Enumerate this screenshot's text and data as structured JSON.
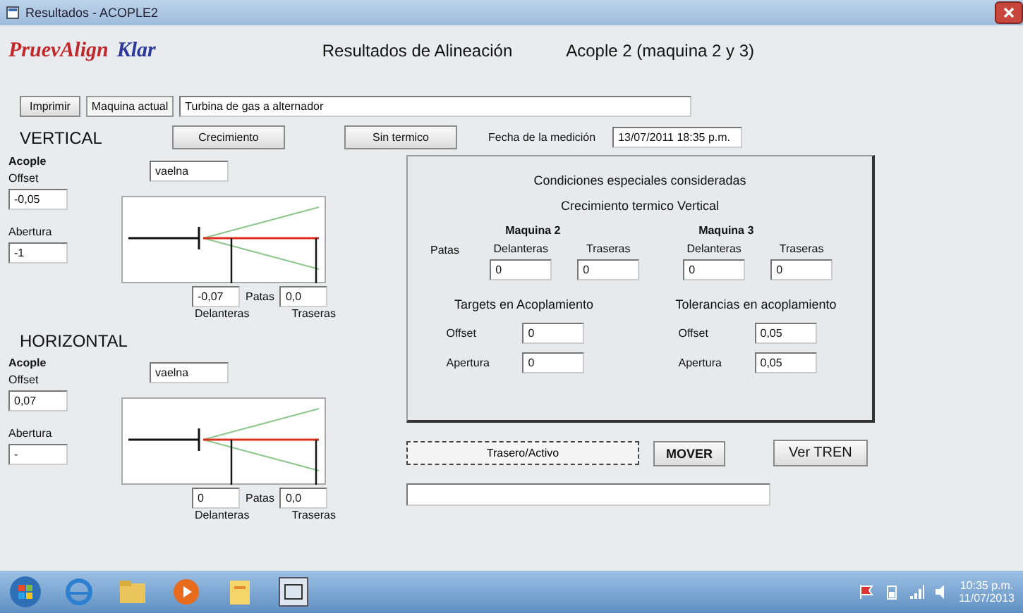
{
  "window": {
    "title": "Resultados - ACOPLE2"
  },
  "header": {
    "logo_part_1": "PruevAlign",
    "logo_part_2": "Klar",
    "title": "Resultados de Alineación",
    "coupling": "Acople 2  (maquina 2 y 3)"
  },
  "toolbar": {
    "print_button": "Imprimir",
    "machine_label": "Maquina actual",
    "machine_value": "Turbina de gas a alternador"
  },
  "options": {
    "buttons": [
      "Crecimiento",
      "Sin termico"
    ],
    "date_label": "Fecha de la medición",
    "date_value": "13/07/2011 18:35 p.m."
  },
  "sections": [
    {
      "title": "VERTICAL",
      "coupling_label": "Acople",
      "coupling_value": "vaelna",
      "offset_label": "Offset",
      "offset_value": "-0,05",
      "opening_label": "Abertura",
      "opening_value": "-1",
      "front_value": "-0,07",
      "feet_label": "Patas",
      "rear_value": "0,0",
      "front_label": "Delanteras",
      "rear_label": "Traseras"
    },
    {
      "title": "HORIZONTAL",
      "coupling_label": "Acople",
      "coupling_value": "vaelna",
      "offset_label": "Offset",
      "offset_value": "0,07",
      "opening_label": "Abertura",
      "opening_value": "-",
      "front_value": "0",
      "feet_label": "Patas",
      "rear_value": "0,0",
      "front_label": "Delanteras",
      "rear_label": "Traseras"
    }
  ],
  "conditions": {
    "title": "Condiciones especiales consideradas",
    "subtitle": "Crecimiento termico Vertical",
    "feet_label": "Patas",
    "machines": [
      {
        "name": "Maquina 2",
        "front_label": "Delanteras",
        "front_value": "0",
        "rear_label": "Traseras",
        "rear_value": "0"
      },
      {
        "name": "Maquina 3",
        "front_label": "Delanteras",
        "front_value": "0",
        "rear_label": "Traseras",
        "rear_value": "0"
      }
    ],
    "targets": {
      "title": "Targets en Acoplamiento",
      "rows": [
        {
          "label": "Offset",
          "value": "0"
        },
        {
          "label": "Apertura",
          "value": "0"
        }
      ]
    },
    "tolerances": {
      "title": "Tolerancias en acoplamiento",
      "rows": [
        {
          "label": "Offset",
          "value": "0,05"
        },
        {
          "label": "Apertura",
          "value": "0,05"
        }
      ]
    }
  },
  "actions": {
    "dropdown": "Trasero/Activo",
    "move_button": "MOVER",
    "train_button": "Ver TREN"
  },
  "taskbar": {
    "time": "10:35 p.m.",
    "date": "11/07/2013"
  }
}
